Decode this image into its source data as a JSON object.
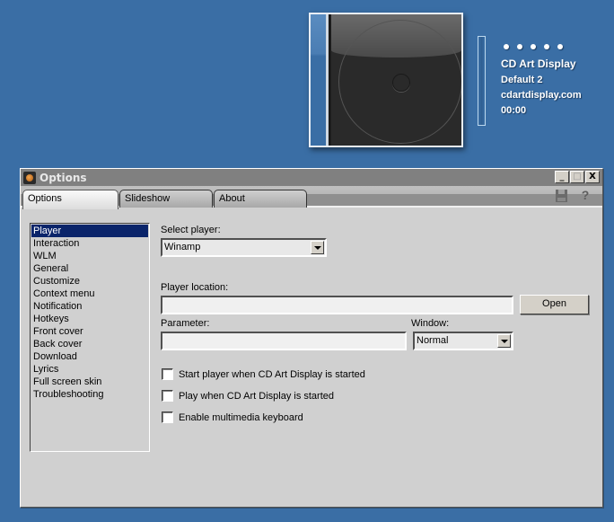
{
  "widget": {
    "rating_dots": 5,
    "title": "CD Art Display",
    "skin": "Default 2",
    "website": "cdartdisplay.com",
    "time": "00:00"
  },
  "window": {
    "title": "Options",
    "controls": {
      "minimize": "_",
      "maximize": "□",
      "close": "X"
    },
    "toolbar": {
      "save_icon": "save-icon",
      "help_icon": "help-icon",
      "help_glyph": "?"
    }
  },
  "tabs": [
    {
      "label": "Options",
      "active": true
    },
    {
      "label": "Slideshow",
      "active": false
    },
    {
      "label": "About",
      "active": false
    }
  ],
  "categories": [
    {
      "label": "Player",
      "selected": true
    },
    {
      "label": "Interaction"
    },
    {
      "label": "WLM"
    },
    {
      "label": "General"
    },
    {
      "label": "Customize"
    },
    {
      "label": "Context menu"
    },
    {
      "label": "Notification"
    },
    {
      "label": "Hotkeys"
    },
    {
      "label": "Front cover"
    },
    {
      "label": "Back cover"
    },
    {
      "label": "Download"
    },
    {
      "label": "Lyrics"
    },
    {
      "label": "Full screen skin"
    },
    {
      "label": "Troubleshooting"
    }
  ],
  "player": {
    "select_player_label": "Select player:",
    "select_player_value": "Winamp",
    "location_label": "Player location:",
    "location_value": "",
    "open_button": "Open",
    "parameter_label": "Parameter:",
    "parameter_value": "",
    "window_label": "Window:",
    "window_value": "Normal",
    "checkboxes": [
      {
        "label": "Start player when CD Art Display is started",
        "checked": false
      },
      {
        "label": "Play when CD Art Display is started",
        "checked": false
      },
      {
        "label": "Enable multimedia keyboard",
        "checked": false
      }
    ]
  }
}
